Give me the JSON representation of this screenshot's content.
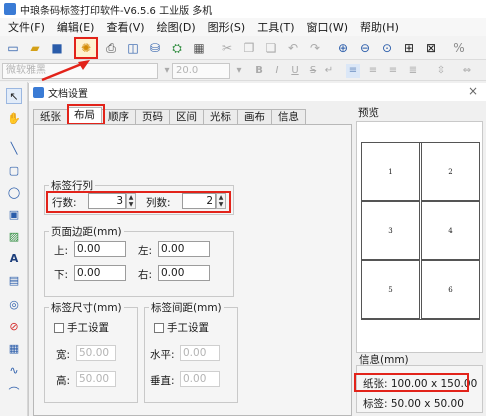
{
  "app": {
    "title": "中琅条码标签打印软件-V6.5.6 工业版 多机"
  },
  "menu": [
    "文件(F)",
    "编辑(E)",
    "查看(V)",
    "绘图(D)",
    "图形(S)",
    "工具(T)",
    "窗口(W)",
    "帮助(H)"
  ],
  "toolbar2": {
    "font": "微软雅黑",
    "size": "20.0"
  },
  "dialog": {
    "title": "文档设置",
    "close": "×",
    "tabs": [
      "纸张",
      "布局",
      "顺序",
      "页码",
      "区间",
      "光标",
      "画布",
      "信息"
    ],
    "active_tab": "布局",
    "rows_group": {
      "legend": "标签行列",
      "rows_label": "行数:",
      "rows_value": "3",
      "cols_label": "列数:",
      "cols_value": "2"
    },
    "margins": {
      "legend": "页面边距(mm)",
      "top_label": "上:",
      "top": "0.00",
      "left_label": "左:",
      "left": "0.00",
      "bottom_label": "下:",
      "bottom": "0.00",
      "right_label": "右:",
      "right": "0.00"
    },
    "size": {
      "legend": "标签尺寸(mm)",
      "manual": "手工设置",
      "width_label": "宽:",
      "width": "50.00",
      "height_label": "高:",
      "height": "50.00"
    },
    "spacing": {
      "legend": "标签间距(mm)",
      "manual": "手工设置",
      "h_label": "水平:",
      "h": "0.00",
      "v_label": "垂直:",
      "v": "0.00"
    },
    "preview": {
      "label": "预览",
      "cells": [
        "1",
        "2",
        "3",
        "4",
        "5",
        "6"
      ]
    },
    "info": {
      "label": "信息(mm)",
      "paper": "纸张: 100.00 x 150.00",
      "label_size": "标签: 50.00 x 50.00"
    }
  },
  "colors": {
    "highlight": "#e2231a",
    "accent": "#2a5caa"
  }
}
